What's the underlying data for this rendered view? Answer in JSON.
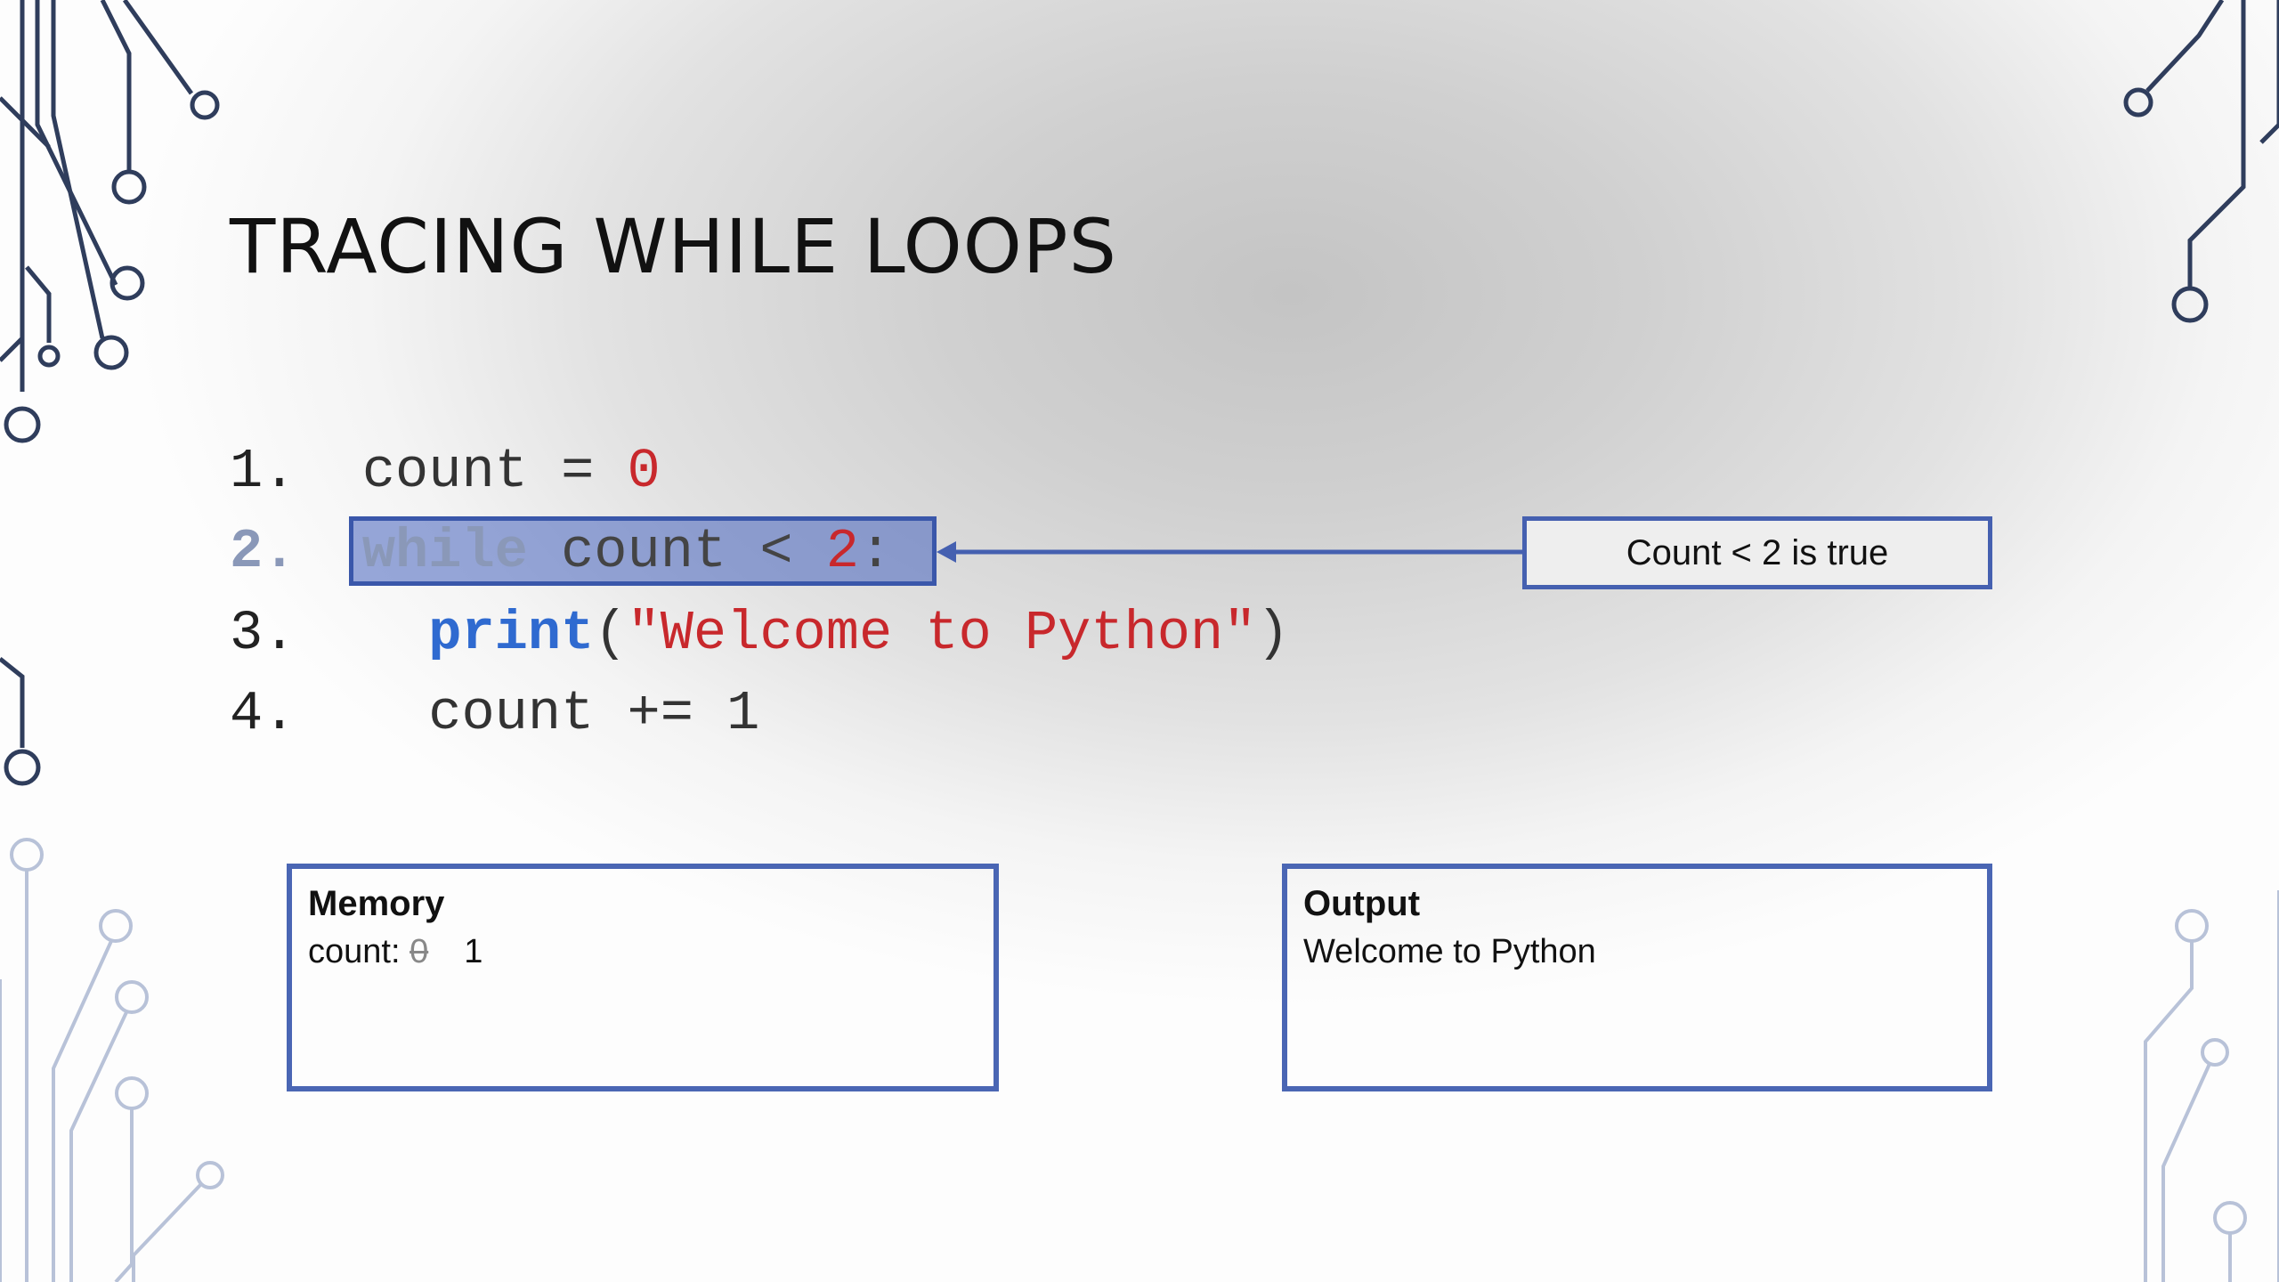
{
  "slide": {
    "title": "TRACING WHILE LOOPS",
    "code_lines": [
      {
        "number": "1.",
        "segments": [
          "count = ",
          "0"
        ]
      },
      {
        "number": "2.",
        "segments": [
          "while",
          " count < ",
          "2",
          ":"
        ]
      },
      {
        "number": "3.",
        "segments": [
          "print",
          "(",
          "\"Welcome to Python\"",
          ")"
        ]
      },
      {
        "number": "4.",
        "segments": [
          "count += 1"
        ]
      }
    ],
    "active_line": 2,
    "callout": "Count < 2 is true",
    "memory": {
      "heading": "Memory",
      "variable_label": "count:",
      "old_value": "0",
      "new_value": "1"
    },
    "output": {
      "heading": "Output",
      "lines": [
        "Welcome to Python"
      ]
    }
  },
  "colors": {
    "accent": "#4a66b4",
    "string_red": "#c8282c",
    "keyword_blue": "#2f6ad0",
    "circuit": "#2f3d5c"
  }
}
